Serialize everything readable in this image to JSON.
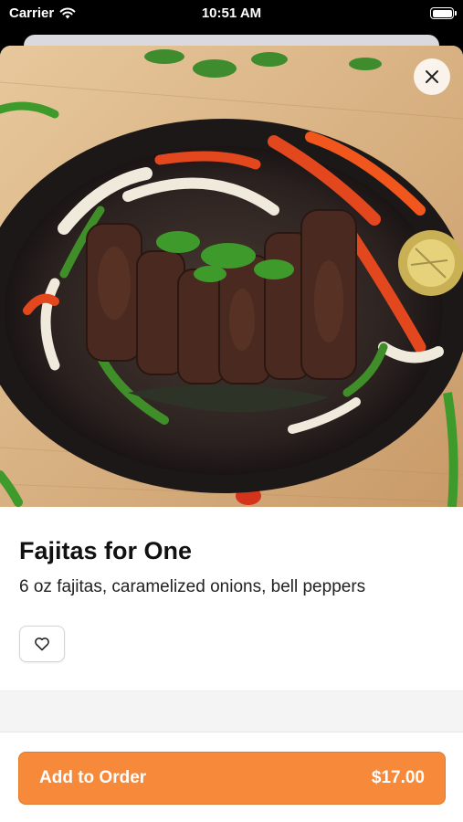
{
  "status_bar": {
    "carrier": "Carrier",
    "time": "10:51 AM"
  },
  "item": {
    "title": "Fajitas for One",
    "description": "6 oz fajitas, caramelized onions, bell peppers"
  },
  "footer": {
    "add_label": "Add to Order",
    "price": "$17.00"
  },
  "icons": {
    "close": "close-icon",
    "favorite": "heart-icon",
    "wifi": "wifi-icon",
    "battery": "battery-icon"
  },
  "colors": {
    "accent": "#f68a3a"
  }
}
